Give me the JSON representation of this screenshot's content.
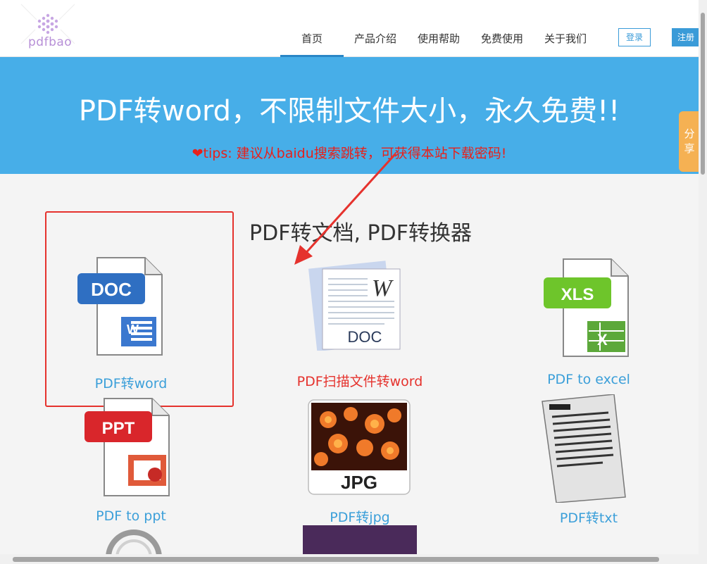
{
  "header": {
    "logo_text": "pdfbao",
    "nav": [
      {
        "label": "首页",
        "active": true
      },
      {
        "label": "产品介绍",
        "active": false
      },
      {
        "label": "使用帮助",
        "active": false
      },
      {
        "label": "免费使用",
        "active": false
      },
      {
        "label": "关于我们",
        "active": false
      }
    ],
    "login_label": "登录",
    "register_label": "注册"
  },
  "hero": {
    "title": "PDF转word，不限制文件大小，永久免费!!",
    "tips": "tips: 建议从baidu搜索跳转，可获得本站下载密码!",
    "heart": "❤"
  },
  "share": {
    "label_1": "分",
    "label_2": "享"
  },
  "section": {
    "title": "PDF转文档, PDF转换器"
  },
  "tiles": [
    {
      "label": "PDF转word",
      "icon": "doc-icon",
      "badge": "DOC"
    },
    {
      "label": "PDF扫描文件转word",
      "icon": "scan-doc-icon",
      "badge": "DOC"
    },
    {
      "label": "PDF to excel",
      "icon": "xls-icon",
      "badge": "XLS"
    },
    {
      "label": "PDF to ppt",
      "icon": "ppt-icon",
      "badge": "PPT"
    },
    {
      "label": "PDF转jpg",
      "icon": "jpg-icon",
      "badge": "JPG"
    },
    {
      "label": "PDF转txt",
      "icon": "txt-icon",
      "badge": ""
    }
  ],
  "colors": {
    "hero_bg": "#47aee8",
    "accent": "#3b9fd9",
    "highlight_red": "#e5322d",
    "share_tab": "#f5b153"
  }
}
